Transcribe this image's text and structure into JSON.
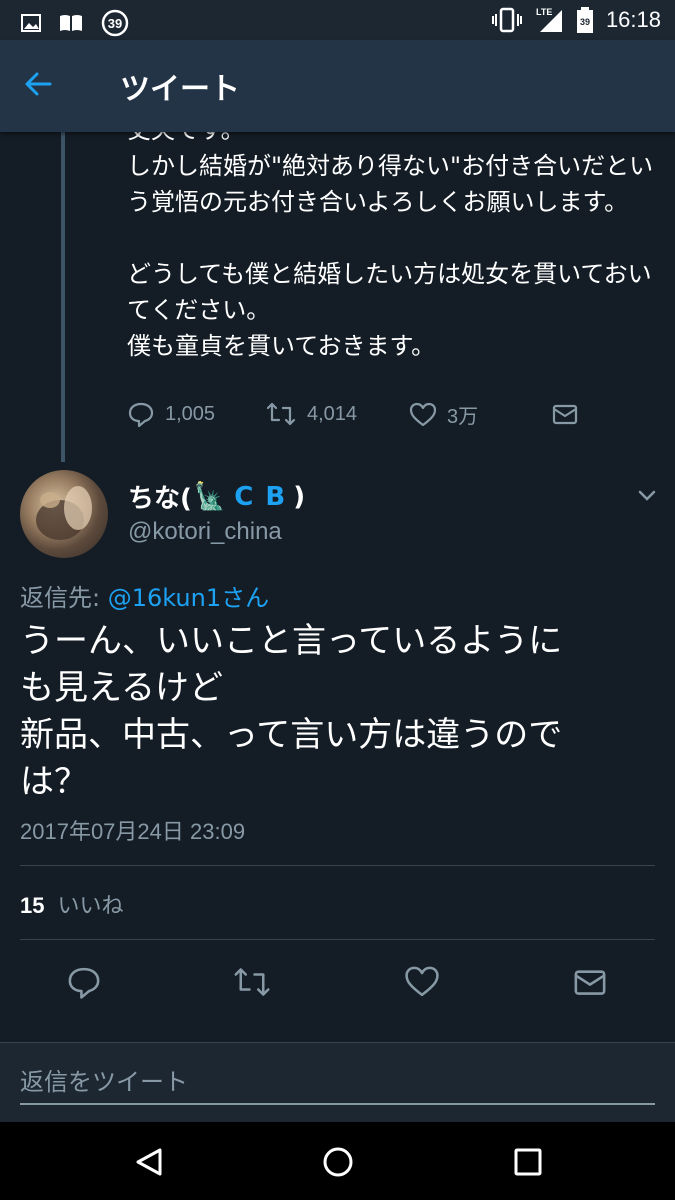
{
  "status_bar": {
    "time": "16:18",
    "notification_badge": "39",
    "battery_badge": "39",
    "network": "LTE",
    "icons": [
      "image-icon",
      "book-icon",
      "badge-39-icon",
      "vibrate-icon",
      "signal-icon",
      "battery-icon"
    ]
  },
  "header": {
    "back_icon": "back-arrow-icon",
    "title": "ツイート"
  },
  "parent_tweet": {
    "text": "丈夫です。\nしかし結婚が\"絶対あり得ない\"お付き合いだという覚悟の元お付き合いよろしくお願いします。\n\nどうしても僕と結婚したい方は処女を貫いておいてください。\n僕も童貞を貫いておきます。",
    "replies": "1,005",
    "retweets": "4,014",
    "likes": "3万"
  },
  "tweet": {
    "author_name": "ちな(",
    "author_emoji": "🗽",
    "author_suffix_1": "C",
    "author_suffix_2": "B",
    "author_close": ")",
    "handle": "@kotori_china",
    "reply_prefix": "返信先:",
    "reply_mention": "@16kun1さん",
    "text": "うーん、いいこと言っているように\nも見えるけど\n新品、中古、って言い方は違うので\nは？",
    "timestamp": "2017年07月24日 23:09",
    "like_count": "15",
    "like_label": "いいね"
  },
  "reply_box": {
    "placeholder": "返信をツイート"
  },
  "colors": {
    "background": "#141d26",
    "header": "#243447",
    "accent": "#1da1f2",
    "muted": "#8899a6"
  }
}
